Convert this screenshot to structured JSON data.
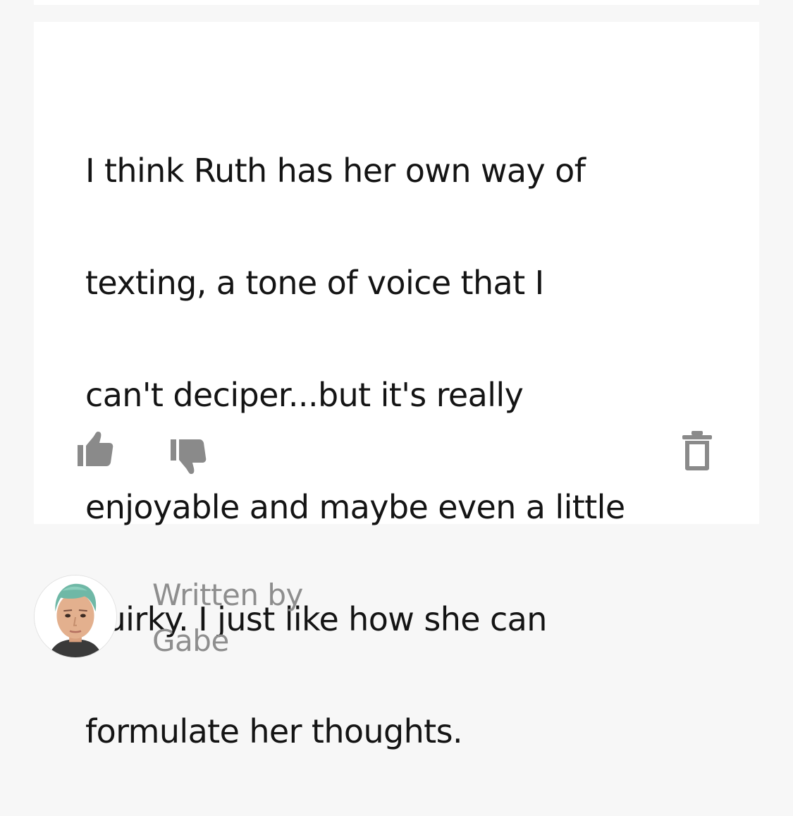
{
  "review": {
    "lines": [
      "I think Ruth has her own way of",
      "texting, a tone of voice that I",
      "can't deciper...but it's really",
      "enjoyable and maybe even a little",
      "quirky. I just like how she can",
      "formulate her thoughts."
    ],
    "actions": {
      "like_icon": "thumbs-up-icon",
      "dislike_icon": "thumbs-down-icon",
      "delete_icon": "trash-icon"
    }
  },
  "author": {
    "label": "Written by",
    "name": "Gabe",
    "avatar": "avatar-teal-hair"
  },
  "colors": {
    "background": "#f7f7f7",
    "card": "#ffffff",
    "text": "#141414",
    "muted": "#8e8e8e",
    "icon": "#8a8a8a"
  }
}
